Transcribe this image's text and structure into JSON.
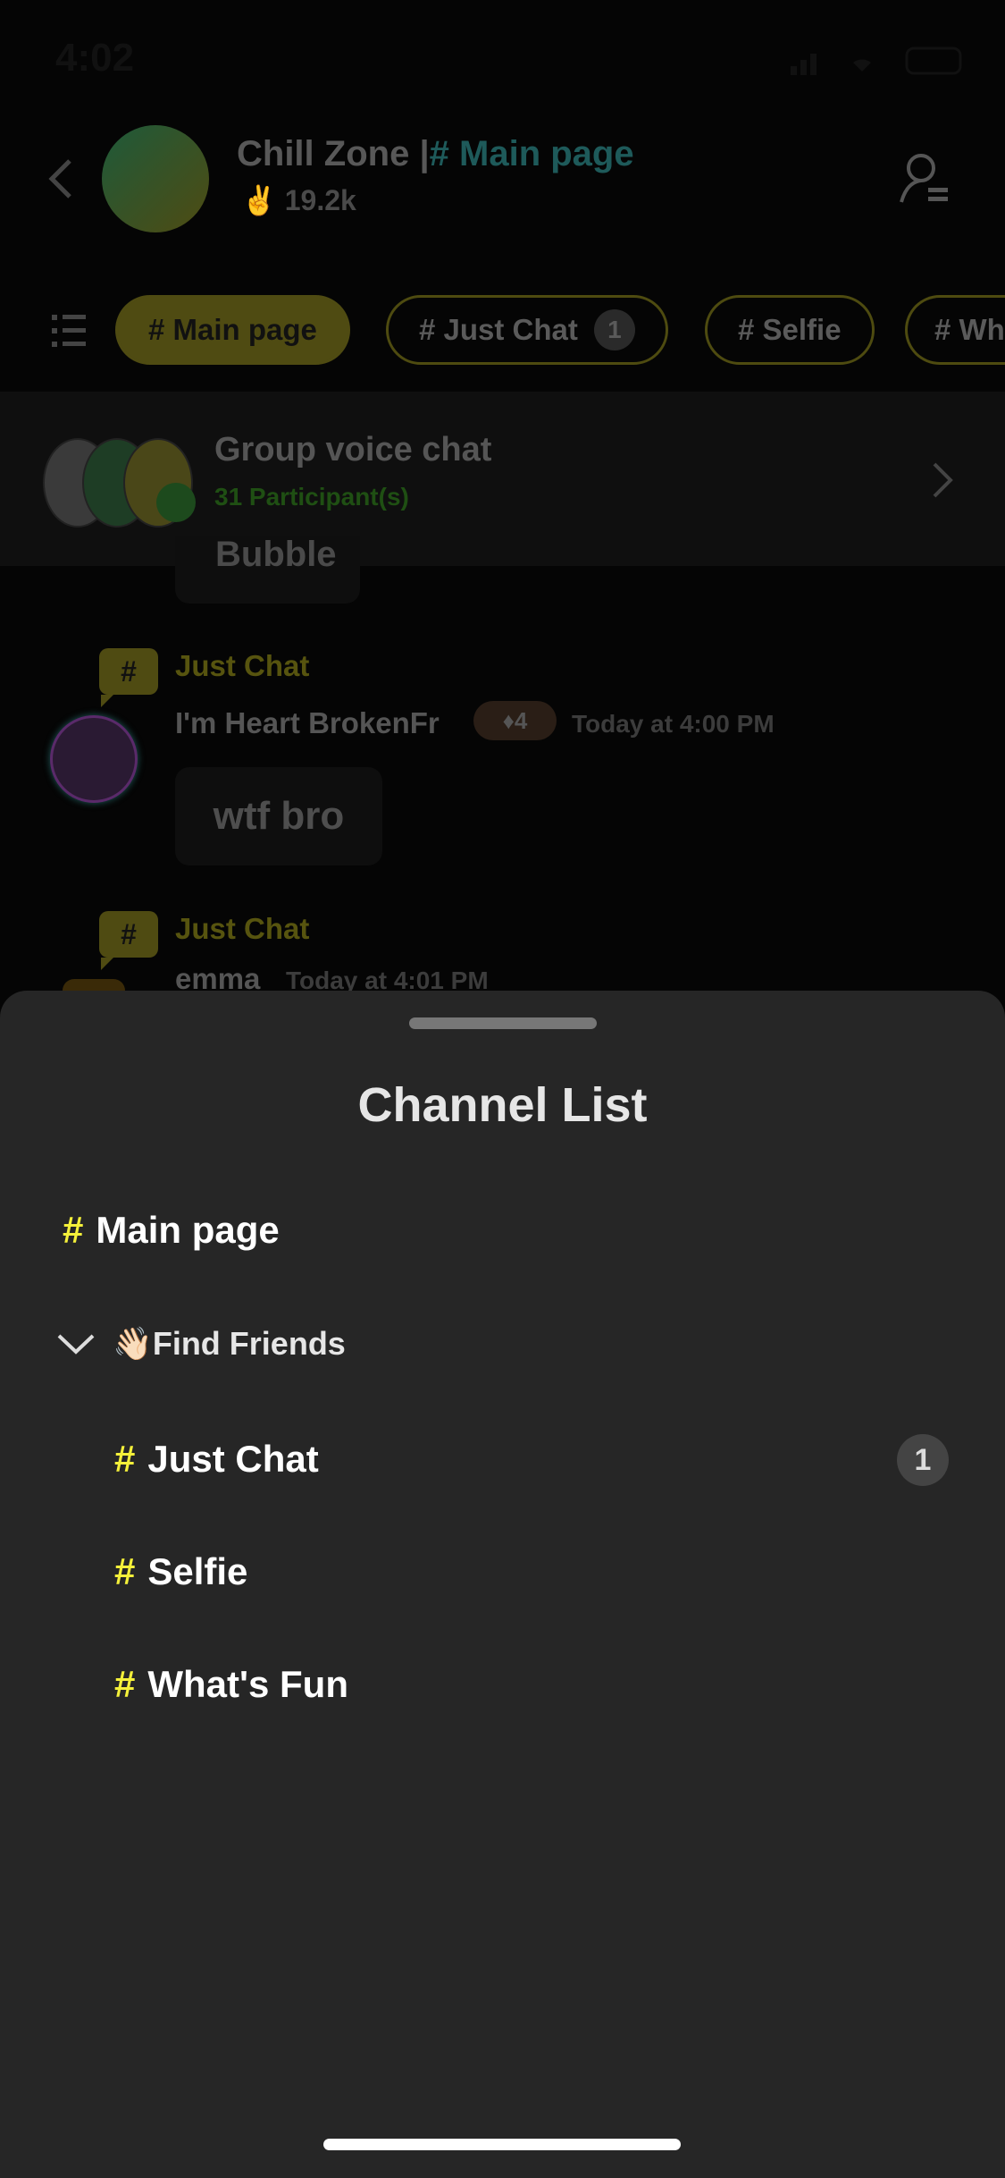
{
  "status_bar": {
    "time": "4:02"
  },
  "header": {
    "server_name": "Chill Zone",
    "separator": "|",
    "channel": "# Main page",
    "members": "19.2k"
  },
  "tabs": [
    {
      "label": "# Main page",
      "active": true
    },
    {
      "label": "# Just Chat",
      "count": "1"
    },
    {
      "label": "# Selfie"
    },
    {
      "label": "# Wh"
    }
  ],
  "voice": {
    "title": "Group voice chat",
    "participants": "31 Participant(s)"
  },
  "messages": [
    {
      "partial_text": "Bubble"
    },
    {
      "channel": "Just Chat",
      "author": "I'm Heart BrokenFr",
      "level": "4",
      "time": "Today at 4:00 PM",
      "text": "wtf bro"
    },
    {
      "channel": "Just Chat",
      "author": "emma",
      "time": "Today at 4:01 PM"
    }
  ],
  "sheet": {
    "title": "Channel List",
    "main": "Main page",
    "category": {
      "emoji": "👋🏻",
      "label": "Find Friends"
    },
    "channels": [
      {
        "label": "Just Chat",
        "unread": "1"
      },
      {
        "label": "Selfie"
      },
      {
        "label": "What's Fun"
      }
    ],
    "hash": "#"
  },
  "colors": {
    "accent": "#f4f03a",
    "sheet_bg": "#262626",
    "active_tab": "#4f4b12"
  }
}
